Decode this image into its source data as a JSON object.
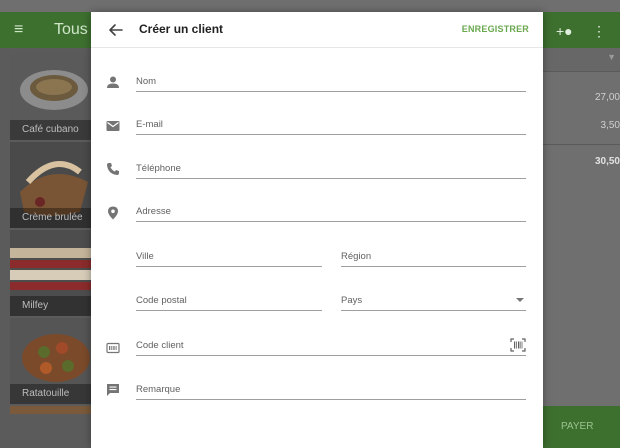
{
  "background": {
    "title": "Tous les",
    "products": [
      {
        "name": "Café cubano"
      },
      {
        "name": "Crème brulée"
      },
      {
        "name": "Milfey"
      },
      {
        "name": "Ratatouille"
      }
    ],
    "amounts": [
      "27,00",
      "3,50"
    ],
    "total": "30,50",
    "pay_label": "PAYER"
  },
  "dialog": {
    "title": "Créer un client",
    "save_label": "ENREGISTRER",
    "fields": {
      "name": {
        "placeholder": "Nom",
        "value": ""
      },
      "email": {
        "placeholder": "E-mail",
        "value": ""
      },
      "phone": {
        "placeholder": "Téléphone",
        "value": ""
      },
      "address": {
        "placeholder": "Adresse",
        "value": ""
      },
      "city": {
        "placeholder": "Ville",
        "value": ""
      },
      "region": {
        "placeholder": "Région",
        "value": ""
      },
      "postal_code": {
        "placeholder": "Code postal",
        "value": ""
      },
      "country": {
        "placeholder": "Pays",
        "value": ""
      },
      "customer_code": {
        "placeholder": "Code client",
        "value": ""
      },
      "note": {
        "placeholder": "Remarque",
        "value": ""
      }
    }
  },
  "colors": {
    "accent": "#6aa84f",
    "topbar": "#3d6f2f",
    "icon": "#757575"
  }
}
